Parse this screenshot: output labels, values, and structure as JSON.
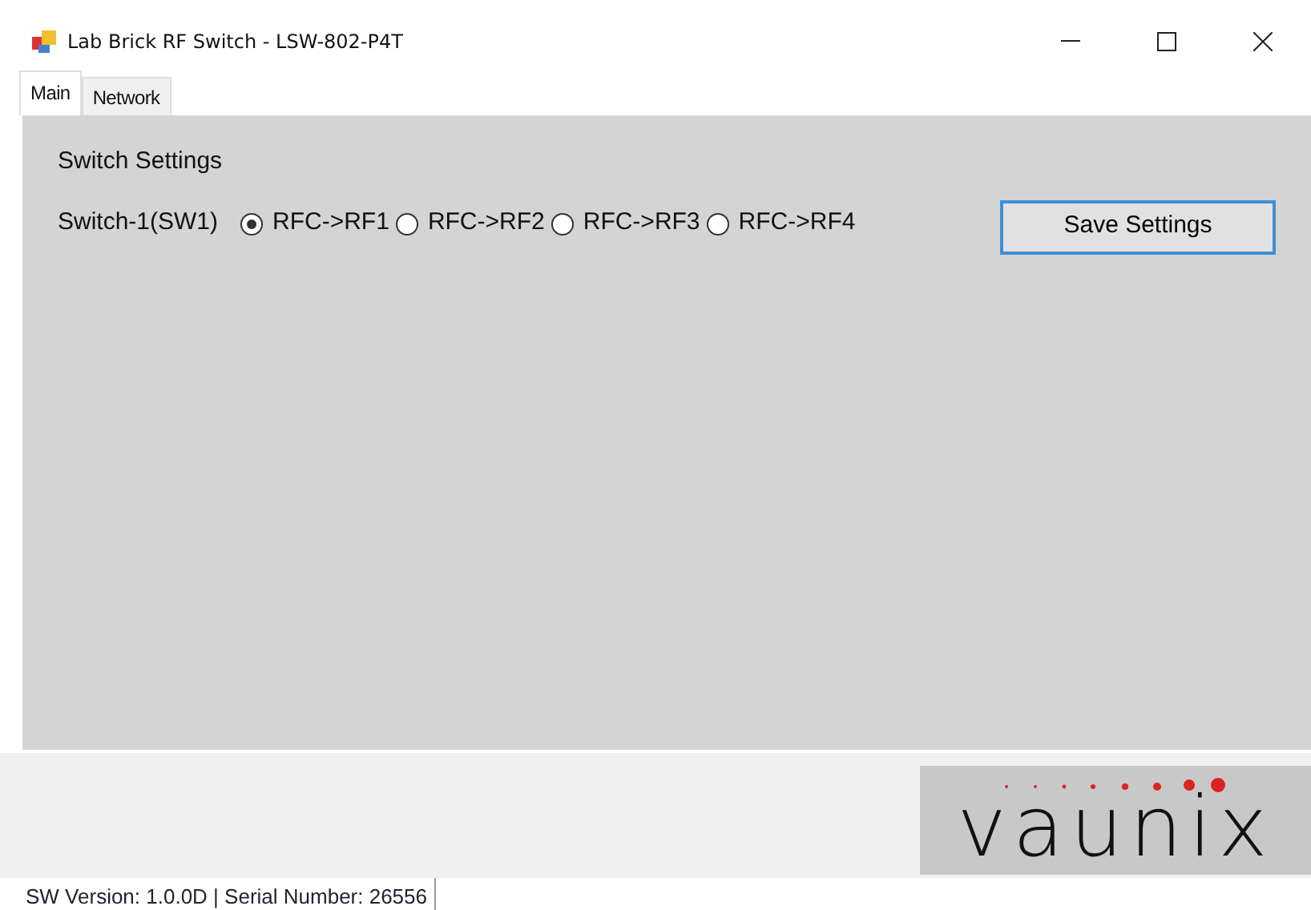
{
  "window": {
    "title": "Lab Brick RF Switch - LSW-802-P4T"
  },
  "tabs": [
    {
      "label": "Main",
      "selected": true
    },
    {
      "label": "Network",
      "selected": false
    }
  ],
  "switch_settings": {
    "title": "Switch Settings",
    "switch_label": "Switch-1(SW1)",
    "options": [
      {
        "label": "RFC->RF1",
        "selected": true
      },
      {
        "label": "RFC->RF2",
        "selected": false
      },
      {
        "label": "RFC->RF3",
        "selected": false
      },
      {
        "label": "RFC->RF4",
        "selected": false
      }
    ],
    "save_button": "Save Settings"
  },
  "logo": {
    "text": "vaunix"
  },
  "status_bar": "SW Version: 1.0.0D | Serial Number: 26556"
}
